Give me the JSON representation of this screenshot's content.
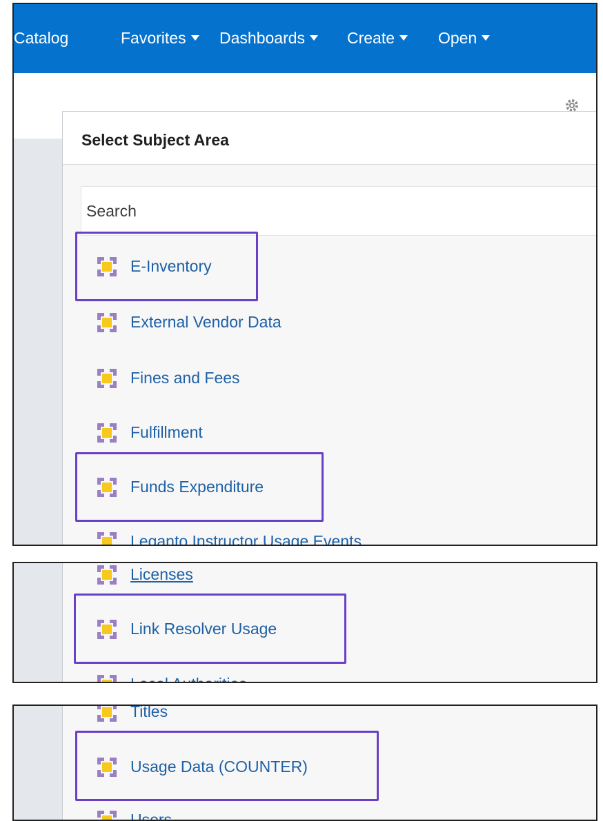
{
  "nav": {
    "items": [
      {
        "label": "Catalog",
        "caret": false
      },
      {
        "label": "Favorites",
        "caret": true
      },
      {
        "label": "Dashboards",
        "caret": true
      },
      {
        "label": "Create",
        "caret": true
      },
      {
        "label": "Open",
        "caret": true
      }
    ]
  },
  "dialog": {
    "title": "Select Subject Area",
    "search_value": "Search"
  },
  "subject_areas": {
    "panel1": [
      "E-Inventory",
      "External Vendor Data",
      "Fines and Fees",
      "Fulfillment",
      "Funds Expenditure",
      "Leganto Instructor Usage Events"
    ],
    "panel2": [
      "Licenses",
      "Link Resolver Usage",
      "Local Authorities"
    ],
    "panel3": [
      "Titles",
      "Usage Data (COUNTER)",
      "Users"
    ]
  },
  "highlighted": [
    "E-Inventory",
    "Funds Expenditure",
    "Link Resolver Usage",
    "Usage Data (COUNTER)"
  ],
  "colors": {
    "topbar": "#0572ce",
    "highlight": "#6a3fc7",
    "link": "#1d60a6",
    "icon_center": "#f7c81e",
    "icon_corners": "#9b7fc4"
  }
}
